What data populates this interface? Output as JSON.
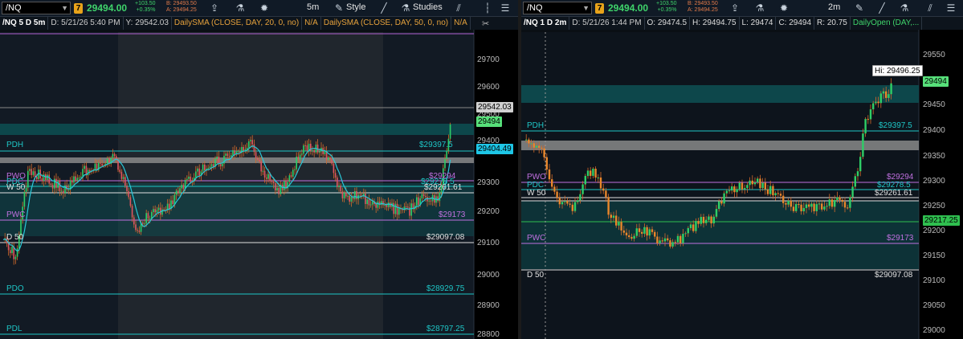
{
  "colors": {
    "bg": "#0a0f14",
    "candle_up": "#2fce66",
    "candle_down": "#e05560",
    "wick": "#d46a2a",
    "sma": "#28c8d8",
    "cyan_level": "#1ec6c6",
    "magenta_level": "#c070e0",
    "white_level": "#e0e0e0",
    "teal_band": "#0e4a4e",
    "gray_band": "#8a8a8a",
    "green_tag": "#57e07a"
  },
  "left": {
    "symbol": "/NQ",
    "badge": "7",
    "last": "29494.00",
    "chg_abs": "+103.50",
    "chg_pct": "+0.35%",
    "bid": "B: 29493.50",
    "ask": "A: 29494.25",
    "period": "5m",
    "style_label": "Style",
    "studies_label": "Studies",
    "info": {
      "sym": "/NQ 5 D 5m",
      "date": "D: 5/21/26 5:40 PM",
      "y": "Y: 29542.03",
      "sma1": "DailySMA (CLOSE, DAY, 20, 0, no)",
      "na1": "N/A",
      "sma2": "DailySMA (CLOSE, DAY, 50, 0, no)",
      "na2": "N/A"
    },
    "y_ticks": [
      "29700",
      "29600",
      "29500",
      "29400",
      "29300",
      "29200",
      "29100",
      "29000",
      "28900",
      "28800"
    ],
    "levels": {
      "pdh": "PDH",
      "pdh_val": "$29397.5",
      "pwo": "PWO",
      "pwo_val": "$29294",
      "pdc": "PDC",
      "pdc_val": "$29278.5",
      "w50": "W 50",
      "w50_val": "$29261.61",
      "pwc": "PWC",
      "pwc_val": "$29173",
      "d50": "D 50",
      "d50_val": "$29097.08",
      "pdo": "PDO",
      "pdo_val": "$28929.75",
      "pdl": "PDL",
      "pdl_val": "$28797.25"
    },
    "tags": {
      "crosshair": "29542.03",
      "last": "29494",
      "cursor": "29404.49"
    }
  },
  "right": {
    "symbol": "/NQ",
    "badge": "7",
    "last": "29494.00",
    "chg_abs": "+103.50",
    "chg_pct": "+0.35%",
    "bid": "B: 29493.50",
    "ask": "A: 29494.25",
    "period": "2m",
    "info": {
      "sym": "/NQ 1 D 2m",
      "date": "D: 5/21/26 1:44 PM",
      "o": "O: 29474.5",
      "h": "H: 29494.75",
      "l": "L: 29474",
      "c": "C: 29494",
      "r": "R: 20.75",
      "daily_open": "DailyOpen (DAY,..."
    },
    "y_ticks": [
      "29550",
      "29500",
      "29450",
      "29400",
      "29350",
      "29300",
      "29250",
      "29200",
      "29150",
      "29100",
      "29050",
      "29000"
    ],
    "levels": {
      "pdh": "PDH",
      "pdh_val": "$29397.5",
      "pwo": "PWO",
      "pwo_val": "$29294",
      "pdc": "PDC",
      "pdc_val": "$29278.5",
      "w50": "W 50",
      "w50_val": "$29261.61",
      "pwc": "PWC",
      "pwc_val": "$29173",
      "d50": "D 50",
      "d50_val": "$29097.08"
    },
    "hi_label": "Hi: 29496.25",
    "tags": {
      "last": "29494",
      "daily_open": "29217.25"
    }
  }
}
